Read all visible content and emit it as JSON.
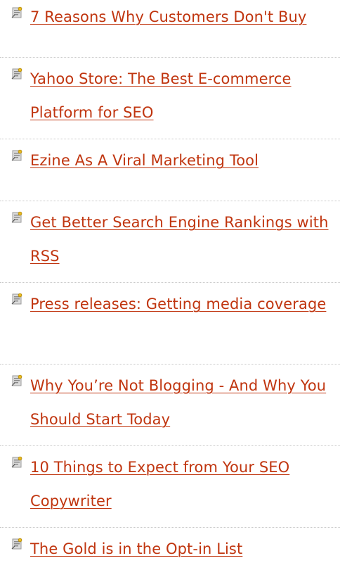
{
  "articles": [
    {
      "title": "7 Reasons Why Customers Don't Buy"
    },
    {
      "title": "Yahoo Store: The Best E-commerce Platform for SEO"
    },
    {
      "title": "Ezine As A Viral Marketing Tool"
    },
    {
      "title": "Get Better Search Engine Rankings with RSS"
    },
    {
      "title": "Press releases: Getting media coverage"
    },
    {
      "title": "Why You’re Not Blogging - And Why You Should Start Today"
    },
    {
      "title": "10 Things to Expect from Your SEO Copywriter"
    },
    {
      "title": "The Gold is in the Opt-in List"
    }
  ],
  "colors": {
    "link": "#c0350f",
    "separator": "#c9c9c9",
    "bullet_light": "#d8d8d8",
    "bullet_dark": "#6e6e6e",
    "bullet_accent": "#e8b820"
  },
  "icons": {
    "bullet": "pushpin-note-icon"
  }
}
